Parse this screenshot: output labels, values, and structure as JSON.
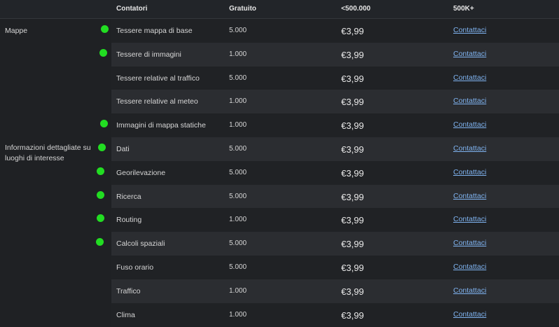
{
  "header": {
    "col_counters": "Contatori",
    "col_free": "Gratuito",
    "col_tier1": "<500.000",
    "col_tier2": "500K+"
  },
  "categories": {
    "maps": "Mappe",
    "poi": "Informazioni dettagliate su luoghi di interesse"
  },
  "status_color": "#22dd22",
  "rows": [
    {
      "name": "Tessere mappa di base",
      "free": "5.000",
      "price": "€3,99",
      "link": "Contattaci",
      "dot": true
    },
    {
      "name": "Tessere di immagini",
      "free": "1.000",
      "price": "€3,99",
      "link": "Contattaci",
      "dot": true
    },
    {
      "name": "Tessere relative al traffico",
      "free": "5.000",
      "price": "€3,99",
      "link": "Contattaci",
      "dot": false
    },
    {
      "name": "Tessere relative al meteo",
      "free": "1.000",
      "price": "€3,99",
      "link": "Contattaci",
      "dot": false
    },
    {
      "name": "Immagini di mappa statiche",
      "free": "1.000",
      "price": "€3,99",
      "link": "Contattaci",
      "dot": true
    },
    {
      "name": "Dati",
      "free": "5.000",
      "price": "€3,99",
      "link": "Contattaci",
      "dot": true
    },
    {
      "name": "Georilevazione",
      "free": "5.000",
      "price": "€3,99",
      "link": "Contattaci",
      "dot": true
    },
    {
      "name": "Ricerca",
      "free": "5.000",
      "price": "€3,99",
      "link": "Contattaci",
      "dot": true
    },
    {
      "name": "Routing",
      "free": "1.000",
      "price": "€3,99",
      "link": "Contattaci",
      "dot": true
    },
    {
      "name": "Calcoli spaziali",
      "free": "5.000",
      "price": "€3,99",
      "link": "Contattaci",
      "dot": true
    },
    {
      "name": "Fuso orario",
      "free": "5.000",
      "price": "€3,99",
      "link": "Contattaci",
      "dot": false
    },
    {
      "name": "Traffico",
      "free": "1.000",
      "price": "€3,99",
      "link": "Contattaci",
      "dot": false
    },
    {
      "name": "Clima",
      "free": "1.000",
      "price": "€3,99",
      "link": "Contattaci",
      "dot": false
    }
  ]
}
